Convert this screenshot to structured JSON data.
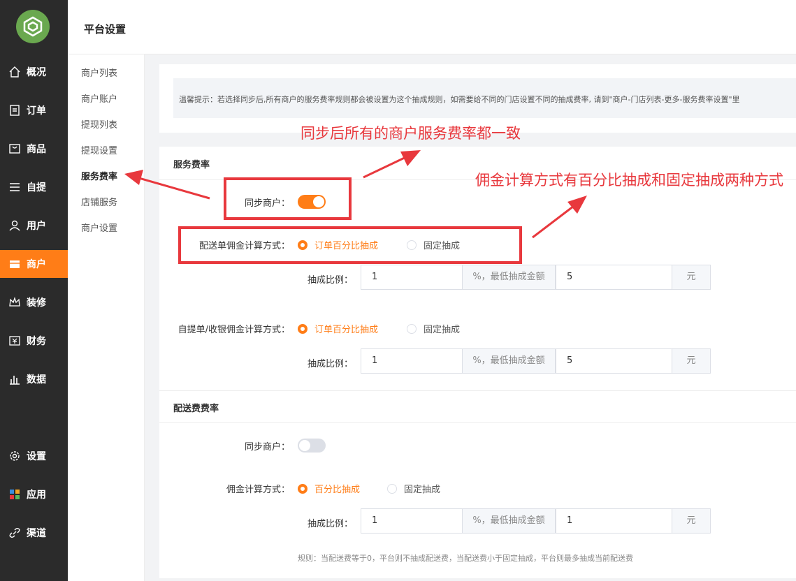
{
  "header": {
    "title": "平台设置"
  },
  "sidebar": {
    "items": [
      {
        "label": "概况",
        "icon": "home-icon"
      },
      {
        "label": "订单",
        "icon": "order-icon"
      },
      {
        "label": "商品",
        "icon": "goods-icon"
      },
      {
        "label": "自提",
        "icon": "list-icon"
      },
      {
        "label": "用户",
        "icon": "user-icon"
      },
      {
        "label": "商户",
        "icon": "store-icon",
        "active": true
      },
      {
        "label": "装修",
        "icon": "crown-icon"
      },
      {
        "label": "财务",
        "icon": "finance-icon"
      },
      {
        "label": "数据",
        "icon": "chart-icon"
      },
      {
        "label": "设置",
        "icon": "gear-icon"
      },
      {
        "label": "应用",
        "icon": "apps-icon"
      },
      {
        "label": "渠道",
        "icon": "link-icon"
      }
    ]
  },
  "submenu": {
    "items": [
      "商户列表",
      "商户账户",
      "提现列表",
      "提现设置",
      "服务费率",
      "店铺服务",
      "商户设置"
    ],
    "active": "服务费率"
  },
  "tip": {
    "text": "温馨提示：若选择同步后,所有商户的服务费率规则都会被设置为这个抽成规则，如需要给不同的门店设置不同的抽成费率, 请到\"商户-门店列表-更多-服务费率设置\"里"
  },
  "service_rate": {
    "title": "服务费率",
    "sync_label": "同步商户：",
    "sync_on": true,
    "delivery_label": "配送单佣金计算方式：",
    "delivery_opt1": "订单百分比抽成",
    "delivery_opt2": "固定抽成",
    "ratio_label": "抽成比例：",
    "ratio1_value": "1",
    "ratio_addon": "%，最低抽成金额",
    "min1_value": "5",
    "yuan": "元",
    "pickup_label": "自提单/收银佣金计算方式：",
    "pickup_opt1": "订单百分比抽成",
    "pickup_opt2": "固定抽成",
    "ratio2_value": "1",
    "min2_value": "5"
  },
  "delivery_fee": {
    "title": "配送费费率",
    "sync_label": "同步商户：",
    "sync_on": false,
    "method_label": "佣金计算方式：",
    "opt1": "百分比抽成",
    "opt2": "固定抽成",
    "ratio_label": "抽成比例：",
    "ratio_value": "1",
    "ratio_addon": "%，最低抽成金额",
    "min_value": "1",
    "yuan": "元",
    "rule": "规则：当配送费等于0，平台则不抽成配送费，当配送费小于固定抽成，平台则最多抽成当前配送费"
  },
  "annotations": {
    "sync_note": "同步后所有的商户服务费率都一致",
    "method_note": "佣金计算方式有百分比抽成和固定抽成两种方式"
  },
  "colors": {
    "accent": "#ff7d17",
    "sidebar": "#2b2b2b",
    "annotation": "#e8383d",
    "logo": "#6aa84f"
  }
}
